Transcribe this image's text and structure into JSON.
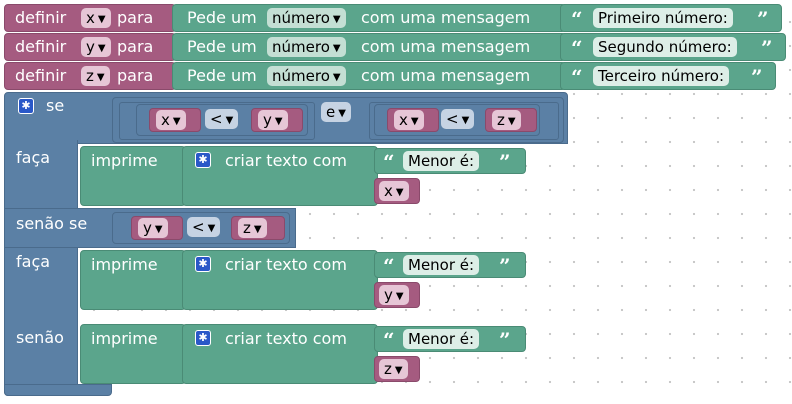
{
  "blocks": {
    "set_x": {
      "label": "definir",
      "var": "x",
      "para": "para",
      "prompt": "Pede um",
      "type": "número",
      "msg": "com uma mensagem",
      "text": "Primeiro número:"
    },
    "set_y": {
      "label": "definir",
      "var": "y",
      "para": "para",
      "prompt": "Pede um",
      "type": "número",
      "msg": "com uma mensagem",
      "text": "Segundo número:"
    },
    "set_z": {
      "label": "definir",
      "var": "z",
      "para": "para",
      "prompt": "Pede um",
      "type": "número",
      "msg": "com uma mensagem",
      "text": "Terceiro número:"
    },
    "if_block": {
      "se": "se",
      "cond1": {
        "left": "x",
        "op": "<",
        "right": "y"
      },
      "and": "e",
      "cond2": {
        "left": "x",
        "op": "<",
        "right": "z"
      },
      "faca1": "faça",
      "print1": {
        "label": "imprime",
        "create": "criar texto com",
        "text": "Menor é:",
        "var": "x"
      },
      "senao_se": "senão se",
      "cond3": {
        "left": "y",
        "op": "<",
        "right": "z"
      },
      "faca2": "faça",
      "print2": {
        "label": "imprime",
        "create": "criar texto com",
        "text": "Menor é:",
        "var": "y"
      },
      "senao": "senão",
      "print3": {
        "label": "imprime",
        "create": "criar texto com",
        "text": "Menor é:",
        "var": "z"
      }
    }
  },
  "colors": {
    "variable": "#a55b80",
    "text": "#5ba58c",
    "logic": "#5b80a5",
    "mutator_icon": "#2a58c8"
  },
  "icons": {
    "dropdown": "▼",
    "mutator": "gear-icon",
    "quote_open": "“",
    "quote_close": "”"
  }
}
